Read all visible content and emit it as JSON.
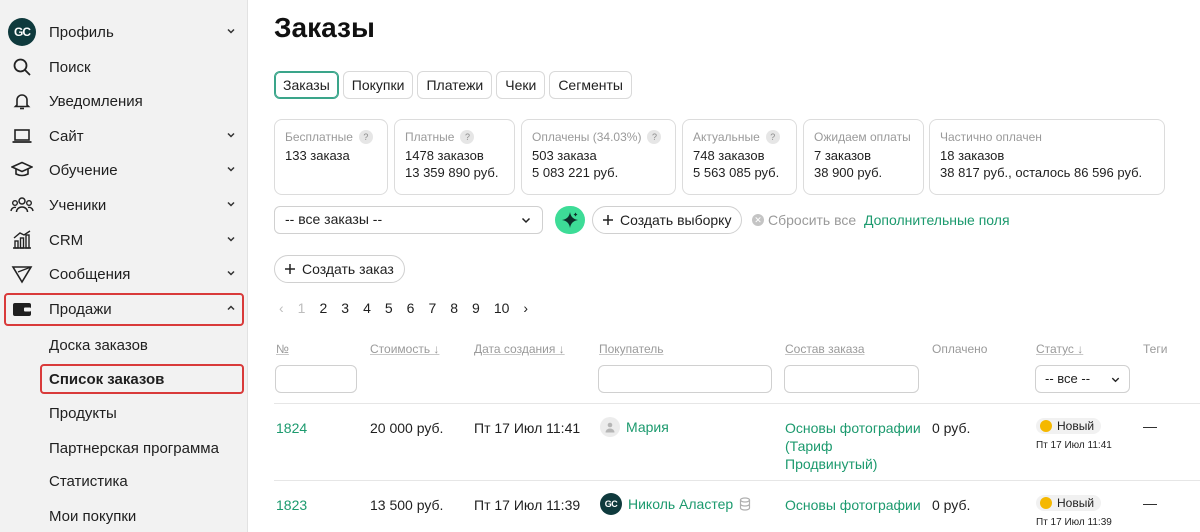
{
  "sidebar": {
    "items": [
      {
        "label": "Профиль",
        "icon": "logo-badge",
        "logo_text": "GC",
        "chevron": "down"
      },
      {
        "label": "Поиск",
        "icon": "search-icon"
      },
      {
        "label": "Уведомления",
        "icon": "bell-icon"
      },
      {
        "label": "Сайт",
        "icon": "laptop-icon",
        "chevron": "down"
      },
      {
        "label": "Обучение",
        "icon": "graduation-cap-icon",
        "chevron": "down"
      },
      {
        "label": "Ученики",
        "icon": "users-icon",
        "chevron": "down"
      },
      {
        "label": "CRM",
        "icon": "chart-icon",
        "chevron": "down"
      },
      {
        "label": "Сообщения",
        "icon": "send-icon",
        "chevron": "down"
      },
      {
        "label": "Продажи",
        "icon": "wallet-icon",
        "chevron": "up",
        "highlighted": true
      }
    ],
    "sales_submenu": [
      {
        "label": "Доска заказов"
      },
      {
        "label": "Список заказов",
        "active": true
      },
      {
        "label": "Продукты"
      },
      {
        "label": "Партнерская программа"
      },
      {
        "label": "Статистика"
      },
      {
        "label": "Мои покупки"
      }
    ]
  },
  "main": {
    "title": "Заказы",
    "tabs": [
      {
        "label": "Заказы",
        "active": true
      },
      {
        "label": "Покупки"
      },
      {
        "label": "Платежи"
      },
      {
        "label": "Чеки"
      },
      {
        "label": "Сегменты"
      }
    ],
    "stats": [
      {
        "caption": "Бесплатные",
        "line1": "133 заказа",
        "line2": ""
      },
      {
        "caption": "Платные",
        "line1": "1478 заказов",
        "line2": "13 359 890 руб."
      },
      {
        "caption": "Оплачены (34.03%)",
        "line1": "503 заказа",
        "line2": "5 083 221 руб."
      },
      {
        "caption": "Актуальные",
        "line1": "748 заказов",
        "line2": "5 563 085 руб."
      },
      {
        "caption": "Ожидаем оплаты",
        "line1": "7 заказов",
        "line2": "38 900 руб."
      },
      {
        "caption": "Частично оплачен",
        "line1": "18 заказов",
        "line2": "38 817 руб., осталось 86 596 руб."
      }
    ],
    "filter_select": "-- все заказы --",
    "create_selection": "Создать выборку",
    "reset_all": "Сбросить все",
    "extra_fields": "Дополнительные поля",
    "create_order": "Создать заказ",
    "pagination": {
      "pages": [
        "1",
        "2",
        "3",
        "4",
        "5",
        "6",
        "7",
        "8",
        "9",
        "10"
      ],
      "current": "1"
    },
    "table": {
      "headers": {
        "number": "№",
        "cost": "Стоимость ↓",
        "created": "Дата создания ↓",
        "buyer": "Покупатель",
        "composition": "Состав заказа",
        "paid": "Оплачено",
        "status": "Статус ↓",
        "tags": "Теги"
      },
      "status_filter": "-- все --",
      "rows": [
        {
          "number": "1824",
          "cost": "20 000 руб.",
          "created": "Пт 17 Июл 11:41",
          "buyer": "Мария",
          "buyer_avatar": "user-icon",
          "product": "Основы фотографии (Тариф Продвинутый)",
          "paid": "0 руб.",
          "status": "Новый",
          "status_time": "Пт 17 Июл 11:41",
          "tags": "—"
        },
        {
          "number": "1823",
          "cost": "13 500 руб.",
          "created": "Пт 17 Июл 11:39",
          "buyer": "Николь Аластер",
          "buyer_avatar": "GC",
          "product": "Основы фотографии",
          "paid": "0 руб.",
          "status": "Новый",
          "status_time": "Пт 17 Июл 11:39",
          "tags": "—"
        }
      ]
    }
  },
  "colors": {
    "accent": "#1c9a6e",
    "highlight": "#d93a3a",
    "status_new": "#f5b800",
    "ai_button": "#3ddc97"
  }
}
